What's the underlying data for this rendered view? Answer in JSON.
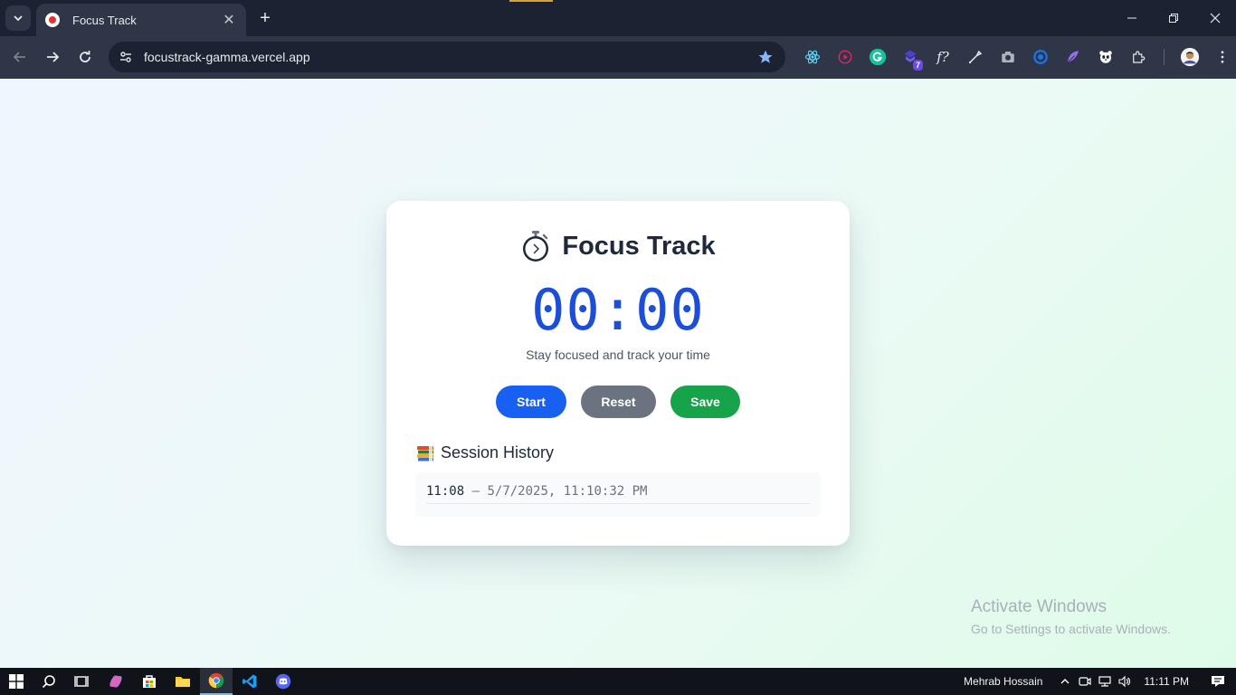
{
  "browser": {
    "tab_title": "Focus Track",
    "url": "focustrack-gamma.vercel.app",
    "extension_badge": "7"
  },
  "app": {
    "title": "Focus Track",
    "timer": "00:00",
    "subtitle": "Stay focused and track your time",
    "buttons": {
      "start": "Start",
      "reset": "Reset",
      "save": "Save"
    },
    "history": {
      "heading": "Session History",
      "sessions": [
        {
          "duration": "11:08",
          "separator": "–",
          "timestamp": "5/7/2025, 11:10:32 PM"
        }
      ]
    }
  },
  "watermark": {
    "line1": "Activate Windows",
    "line2": "Go to Settings to activate Windows."
  },
  "taskbar": {
    "user": "Mehrab Hossain",
    "time": "11:11 PM"
  },
  "colors": {
    "timer": "#1d4ed8",
    "start": "#1860f2",
    "reset": "#6b7280",
    "save": "#16a34a"
  }
}
